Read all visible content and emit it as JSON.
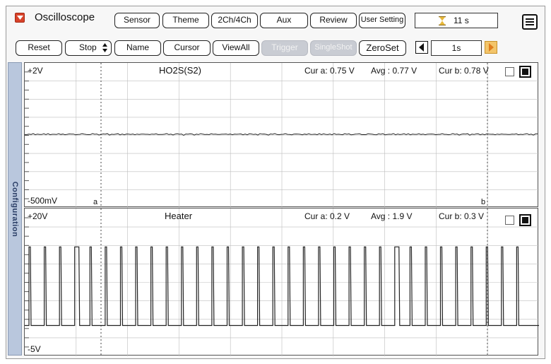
{
  "app": {
    "title": "Oscilloscope",
    "logo_icon": "app-logo-icon"
  },
  "toolbar_top": {
    "sensor": "Sensor",
    "theme": "Theme",
    "channels": "2Ch/4Ch",
    "aux": "Aux",
    "review": "Review",
    "user_setting": "User Setting",
    "timer": {
      "icon": "hourglass-icon",
      "value": "11 s"
    },
    "menu_icon": "menu-icon"
  },
  "toolbar_bottom": {
    "reset": "Reset",
    "stop": "Stop",
    "name": "Name",
    "cursor": "Cursor",
    "view_all": "ViewAll",
    "trigger": "Trigger",
    "single_shot": "SingleShot",
    "zero_set": "ZeroSet",
    "time_step": "1s"
  },
  "side_tab": "Configuration",
  "channels": [
    {
      "name": "HO2S(S2)",
      "top_scale": "+2V",
      "bottom_scale": "-500mV",
      "cur_a": "Cur a: 0.75 V",
      "avg": "Avg  : 0.77 V",
      "cur_b": "Cur b: 0.78 V",
      "cursor_a_label": "a",
      "cursor_b_label": "b",
      "range_v": [
        -0.5,
        2
      ],
      "signal_level_v": 0.77
    },
    {
      "name": "Heater",
      "top_scale": "+20V",
      "bottom_scale": "-5V",
      "cur_a": "Cur a: 0.2 V",
      "avg": "Avg  : 1.9 V",
      "cur_b": "Cur b: 0.3 V",
      "range_v": [
        -5,
        20
      ],
      "pulse_low_v": 0.2,
      "pulse_high_v": 13.5,
      "pulse_count": 33
    }
  ],
  "colors": {
    "trace": "#222222",
    "side_tab": "#b9c7dd",
    "logo": "#d8432a"
  }
}
